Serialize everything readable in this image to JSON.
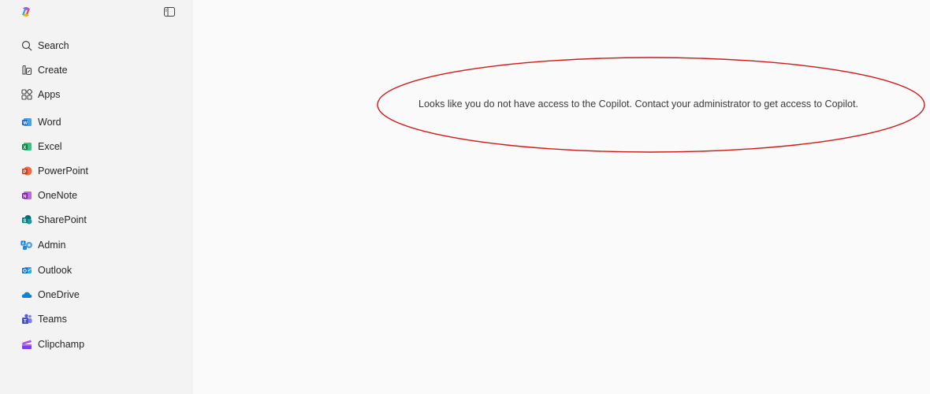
{
  "sidebar": {
    "items": [
      {
        "label": "Search",
        "icon": "search-icon",
        "color": "#424242"
      },
      {
        "label": "Create",
        "icon": "create-icon",
        "color": "#424242"
      },
      {
        "label": "Apps",
        "icon": "apps-icon",
        "color": "#424242"
      },
      {
        "label": "Word",
        "icon": "word-icon",
        "color": "#185abd"
      },
      {
        "label": "Excel",
        "icon": "excel-icon",
        "color": "#107c41"
      },
      {
        "label": "PowerPoint",
        "icon": "powerpoint-icon",
        "color": "#c43e1c"
      },
      {
        "label": "OneNote",
        "icon": "onenote-icon",
        "color": "#7719aa"
      },
      {
        "label": "SharePoint",
        "icon": "sharepoint-icon",
        "color": "#038387"
      },
      {
        "label": "Admin",
        "icon": "admin-icon",
        "color": "#0078d4"
      },
      {
        "label": "Outlook",
        "icon": "outlook-icon",
        "color": "#0f6cbd"
      },
      {
        "label": "OneDrive",
        "icon": "onedrive-icon",
        "color": "#0a84d8"
      },
      {
        "label": "Teams",
        "icon": "teams-icon",
        "color": "#5b5fc7"
      },
      {
        "label": "Clipchamp",
        "icon": "clipchamp-icon",
        "color": "#7b3ff2"
      }
    ]
  },
  "main": {
    "message": "Looks like you do not have access to the Copilot. Contact your administrator to get access to Copilot."
  },
  "colors": {
    "sidebar_bg": "#f3f3f3",
    "page_bg": "#fafafa",
    "annotation": "#d01a1a"
  }
}
